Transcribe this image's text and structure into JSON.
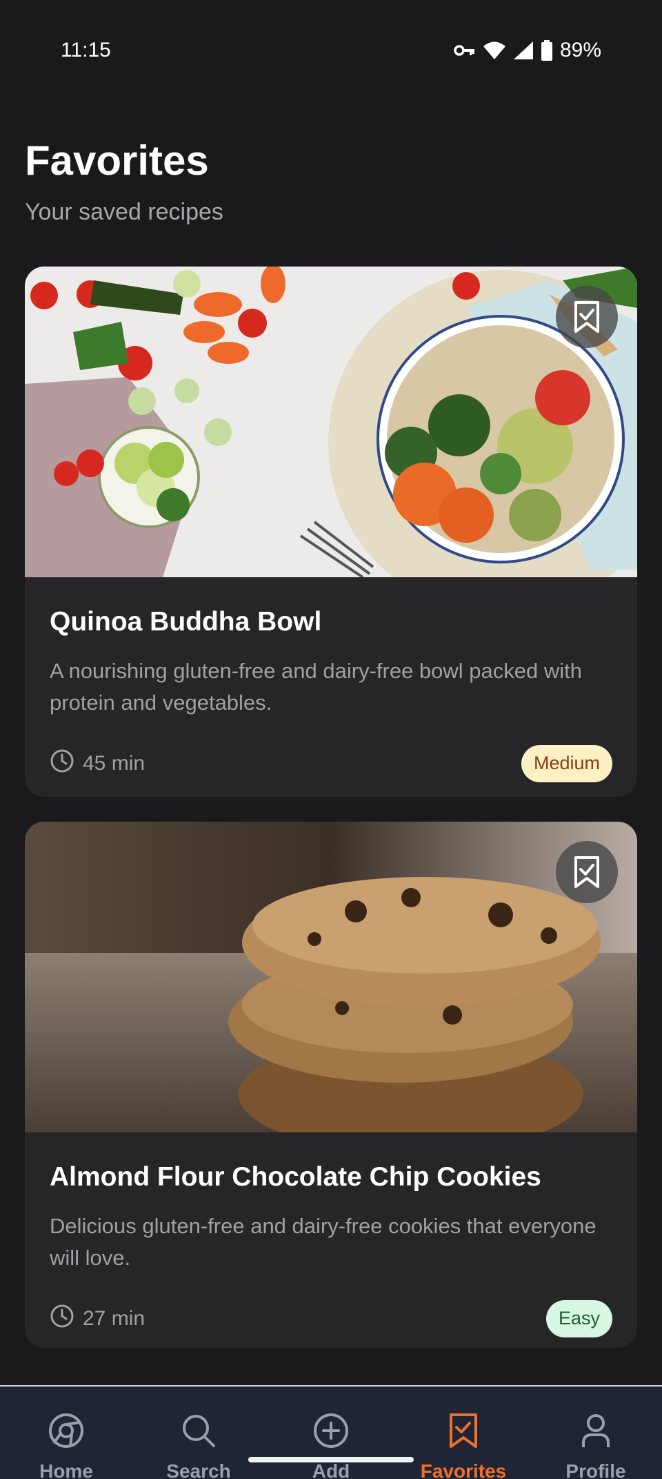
{
  "status_bar": {
    "time": "11:15",
    "battery": "89%",
    "icons": [
      "vpn-key-icon",
      "wifi-icon",
      "signal-icon",
      "battery-icon"
    ]
  },
  "header": {
    "title": "Favorites",
    "subtitle": "Your saved recipes"
  },
  "recipes": [
    {
      "title": "Quinoa Buddha Bowl",
      "description": "A nourishing gluten-free and dairy-free bowl packed with protein and vegetables.",
      "time": "45 min",
      "difficulty": "Medium",
      "bookmarked": true
    },
    {
      "title": "Almond Flour Chocolate Chip Cookies",
      "description": "Delicious gluten-free and dairy-free cookies that everyone will love.",
      "time": "27 min",
      "difficulty": "Easy",
      "bookmarked": true
    }
  ],
  "nav": {
    "items": [
      {
        "label": "Home",
        "icon": "home-logo-icon"
      },
      {
        "label": "Search",
        "icon": "search-icon"
      },
      {
        "label": "Add",
        "icon": "add-circle-icon"
      },
      {
        "label": "Favorites",
        "icon": "bookmark-check-icon"
      },
      {
        "label": "Profile",
        "icon": "person-icon"
      }
    ],
    "active": "Favorites"
  },
  "colors": {
    "background": "#1a1a1c",
    "card": "#262628",
    "accent": "#f26f2a",
    "nav_background": "#1f2535",
    "badge_medium_bg": "#fdf0c4",
    "badge_medium_text": "#8a3d12",
    "badge_easy_bg": "#d8f7e2",
    "badge_easy_text": "#1c5b36"
  }
}
